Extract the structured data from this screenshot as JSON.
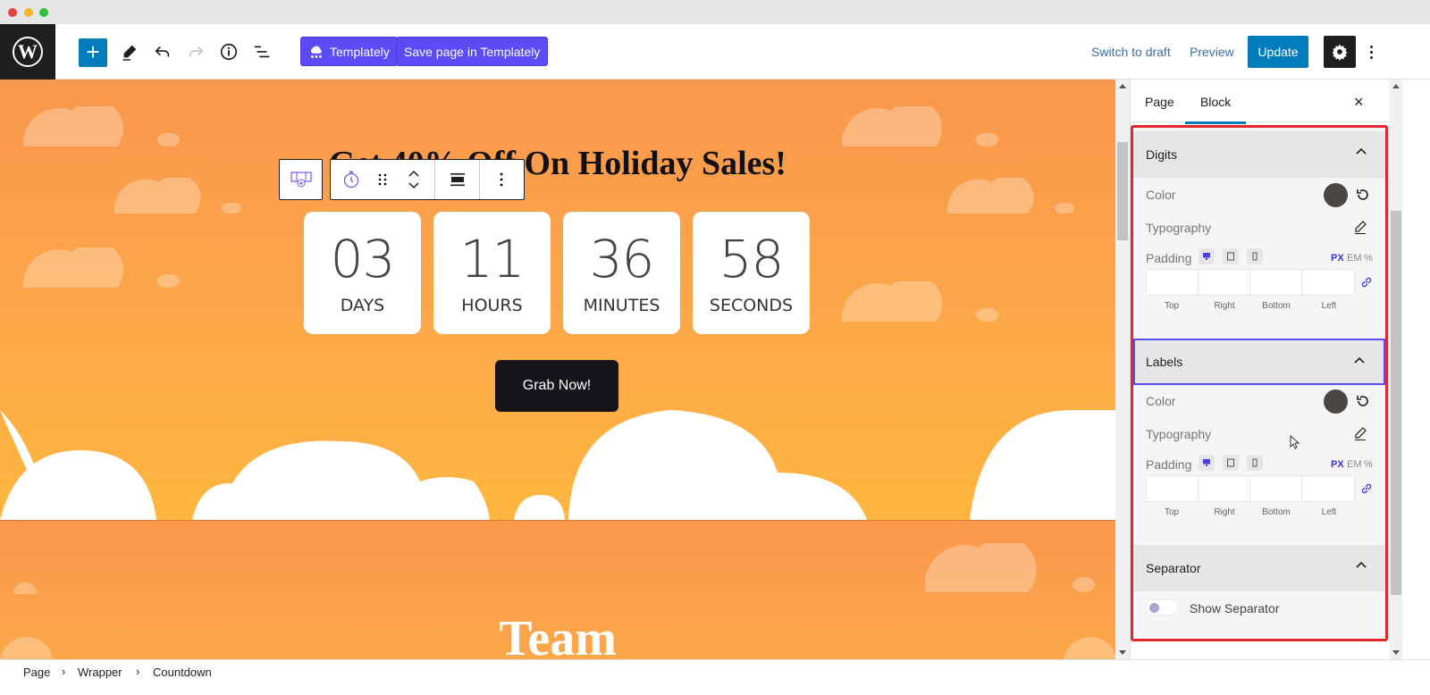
{
  "window": {
    "controls": [
      "close",
      "minimize",
      "maximize"
    ]
  },
  "toolbar": {
    "logo": "wordpress-logo",
    "add_block": "+",
    "icons": [
      "edit-pencil-icon",
      "undo-icon",
      "redo-icon",
      "info-icon",
      "list-view-icon"
    ],
    "templately_label": "Templately",
    "save_templately_label": "Save page in Templately",
    "switch_draft_label": "Switch to draft",
    "preview_label": "Preview",
    "update_label": "Update",
    "accent": "#007cba",
    "templately_color": "#5c4cf7"
  },
  "canvas": {
    "hero_title": "Get 40% Off On Holiday Sales!",
    "countdown": [
      {
        "value": "03",
        "label": "DAYS"
      },
      {
        "value": "11",
        "label": "HOURS"
      },
      {
        "value": "36",
        "label": "MINUTES"
      },
      {
        "value": "58",
        "label": "SECONDS"
      }
    ],
    "cta_label": "Grab Now!",
    "section2_title": "Team"
  },
  "sidebar": {
    "tabs": [
      {
        "label": "Page",
        "active": false
      },
      {
        "label": "Block",
        "active": true
      }
    ],
    "close_label": "×",
    "sections": [
      {
        "title": "Digits",
        "color_label": "Color",
        "color_value": "#4a4643",
        "typography_label": "Typography",
        "padding_label": "Padding",
        "units": [
          "PX",
          "EM",
          "%"
        ],
        "active_unit": "PX",
        "padding_fields": [
          {
            "caption": "Top",
            "value": ""
          },
          {
            "caption": "Right",
            "value": ""
          },
          {
            "caption": "Bottom",
            "value": ""
          },
          {
            "caption": "Left",
            "value": ""
          }
        ]
      },
      {
        "title": "Labels",
        "color_label": "Color",
        "color_value": "#4a4643",
        "typography_label": "Typography",
        "padding_label": "Padding",
        "units": [
          "PX",
          "EM",
          "%"
        ],
        "active_unit": "PX",
        "padding_fields": [
          {
            "caption": "Top",
            "value": ""
          },
          {
            "caption": "Right",
            "value": ""
          },
          {
            "caption": "Bottom",
            "value": ""
          },
          {
            "caption": "Left",
            "value": ""
          }
        ]
      },
      {
        "title": "Separator",
        "toggle_label": "Show Separator",
        "toggle_on": false
      }
    ]
  },
  "breadcrumb": [
    "Page",
    "Wrapper",
    "Countdown"
  ]
}
